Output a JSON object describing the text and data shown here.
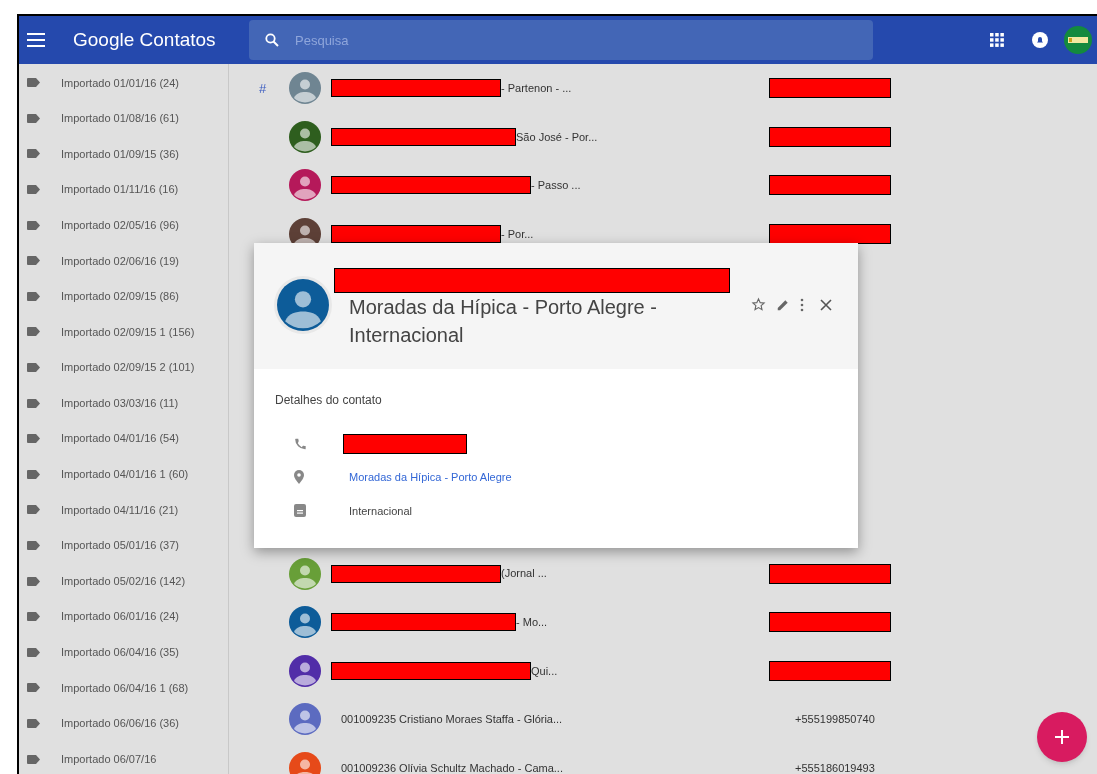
{
  "app_bar": {
    "title": "Google Contatos",
    "search": {
      "placeholder": "Pesquisa"
    }
  },
  "sidebar": {
    "items": [
      {
        "label": "Importado 01/01/16 (24)"
      },
      {
        "label": "Importado 01/08/16 (61)"
      },
      {
        "label": "Importado 01/09/15 (36)"
      },
      {
        "label": "Importado 01/11/16 (16)"
      },
      {
        "label": "Importado 02/05/16 (96)"
      },
      {
        "label": "Importado 02/06/16 (19)"
      },
      {
        "label": "Importado 02/09/15 (86)"
      },
      {
        "label": "Importado 02/09/15 1 (156)"
      },
      {
        "label": "Importado 02/09/15 2 (101)"
      },
      {
        "label": "Importado 03/03/16 (11)"
      },
      {
        "label": "Importado 04/01/16 (54)"
      },
      {
        "label": "Importado 04/01/16 1 (60)"
      },
      {
        "label": "Importado 04/11/16 (21)"
      },
      {
        "label": "Importado 05/01/16 (37)"
      },
      {
        "label": "Importado 05/02/16 (142)"
      },
      {
        "label": "Importado 06/01/16 (24)"
      },
      {
        "label": "Importado 06/04/16 (35)"
      },
      {
        "label": "Importado 06/04/16 1 (68)"
      },
      {
        "label": "Importado 06/06/16 (36)"
      },
      {
        "label": "Importado 06/07/16"
      }
    ]
  },
  "contacts_before": [
    {
      "section": "#",
      "color": "#6f8592",
      "name_redacted": true,
      "name": "- Partenon - ...",
      "phone_redacted": true
    },
    {
      "color": "#2e5e1e",
      "name_redacted": true,
      "name": "São José - Por...",
      "phone_redacted": true
    },
    {
      "color": "#b5195a",
      "name_redacted": true,
      "name": "- Passo ...",
      "phone_redacted": true
    },
    {
      "color": "#5d4037",
      "name_redacted": true,
      "name": "- Por...",
      "phone_redacted": true
    }
  ],
  "contacts_after": [
    {
      "color": "#689f38",
      "name_redacted": true,
      "name": "(Jornal ...",
      "phone_redacted": true
    },
    {
      "color": "#0d5c99",
      "name_redacted": true,
      "name": "- Mo...",
      "phone_redacted": true
    },
    {
      "color": "#512da8",
      "name_redacted": true,
      "name": "Qui...",
      "phone_redacted": true
    },
    {
      "color": "#5c6bc0",
      "name_redacted": false,
      "name": "001009235 Cristiano Moraes Staffa - Glória...",
      "phone_redacted": false,
      "phone": "+555199850740"
    },
    {
      "color": "#e64a19",
      "name_redacted": false,
      "name": "001009236 Olívia Schultz Machado - Cama...",
      "phone_redacted": false,
      "phone": "+555186019493"
    }
  ],
  "contact_card": {
    "color": "#0d5c99",
    "name_redacted": true,
    "title": "Moradas da Hípica - Porto Alegre - Internacional",
    "section_title": "Detalhes do contato",
    "details": [
      {
        "kind": "phone",
        "redacted": true
      },
      {
        "kind": "address",
        "text": "Moradas da Hípica - Porto Alegre"
      },
      {
        "kind": "note",
        "text": "Internacional"
      }
    ]
  }
}
